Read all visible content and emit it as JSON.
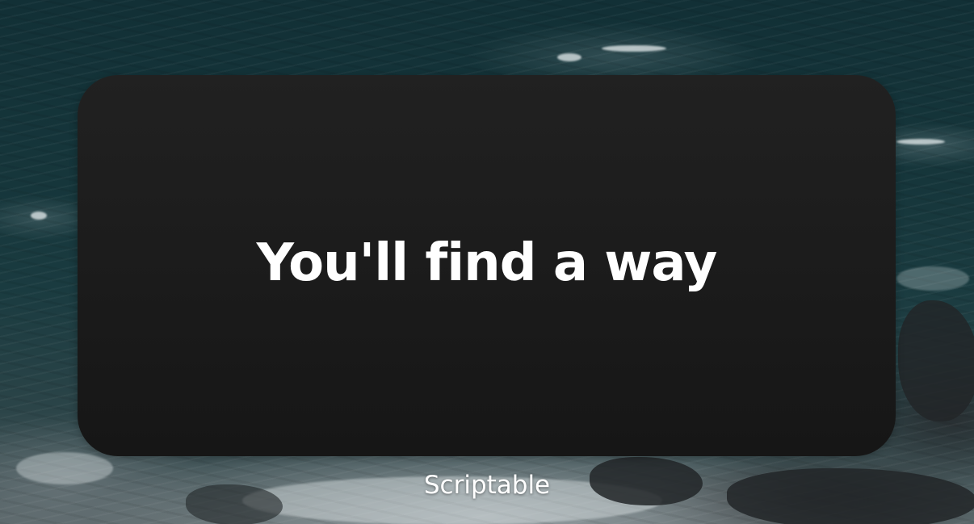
{
  "widget": {
    "quote": "You'll find a way"
  },
  "app_label": "Scriptable"
}
